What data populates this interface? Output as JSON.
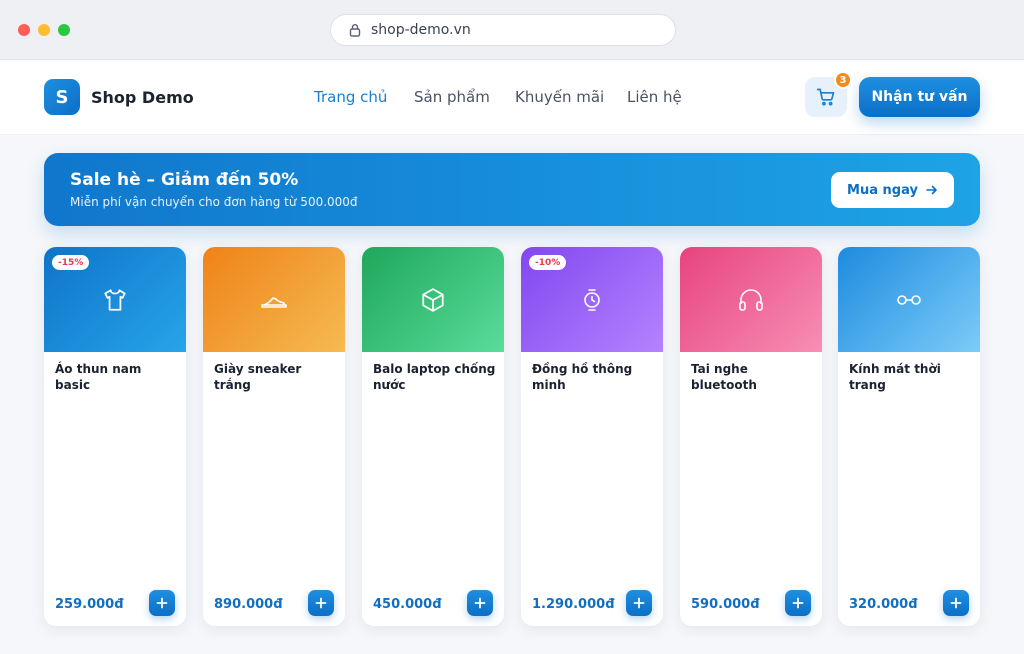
{
  "browser": {
    "url": "shop-demo.vn"
  },
  "header": {
    "logo_letter": "S",
    "brand": "Shop Demo",
    "nav": [
      "Trang chủ",
      "Sản phẩm",
      "Khuyến mãi",
      "Liên hệ"
    ],
    "active_nav": "Trang chủ",
    "cart_count": "3",
    "cta_label": "Nhận tư vấn"
  },
  "banner": {
    "title": "Sale hè – Giảm đến 50%",
    "subtitle": "Miễn phí vận chuyển cho đơn hàng từ 500.000đ",
    "button_label": "Mua ngay"
  },
  "colors": {
    "accent": "#1a7fd0",
    "badge": "#f28a1e",
    "discount": "#e53950"
  },
  "products": [
    {
      "name": "Áo thun nam basic",
      "price": "259.000đ",
      "discount": "-15%",
      "icon": "tshirt-icon"
    },
    {
      "name": "Giày sneaker trắng",
      "price": "890.000đ",
      "discount": "",
      "icon": "sneaker-icon"
    },
    {
      "name": "Balo laptop chống nước",
      "price": "450.000đ",
      "discount": "",
      "icon": "box-icon"
    },
    {
      "name": "Đồng hồ thông minh",
      "price": "1.290.000đ",
      "discount": "-10%",
      "icon": "watch-icon"
    },
    {
      "name": "Tai nghe bluetooth",
      "price": "590.000đ",
      "discount": "",
      "icon": "headphones-icon"
    },
    {
      "name": "Kính mát thời trang",
      "price": "320.000đ",
      "discount": "",
      "icon": "glasses-icon"
    }
  ]
}
